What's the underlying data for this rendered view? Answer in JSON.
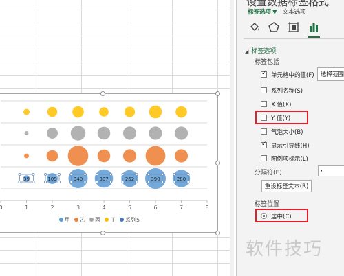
{
  "pane": {
    "title": "设置数据标签格式",
    "tab_active": "标签选项",
    "tab_caret": "▼",
    "tab_other": "文本选项",
    "icons": [
      "fill-icon",
      "pentagon-icon",
      "size-properties-icon",
      "bar-chart-icon"
    ],
    "section_title": "标签选项",
    "label_contains": "标签包括",
    "options": [
      {
        "label": "单元格中的值(F)",
        "checked": true
      },
      {
        "label": "系列名称(S)",
        "checked": false
      },
      {
        "label": "X 值(X)",
        "checked": false
      },
      {
        "label": "Y 值(Y)",
        "checked": false
      },
      {
        "label": "气泡大小(B)",
        "checked": false
      },
      {
        "label": "显示引导线(H)",
        "checked": true
      },
      {
        "label": "图例项标示(L)",
        "checked": false
      }
    ],
    "range_button": "选择范围...",
    "separator_label": "分隔符(E)",
    "separator_value": ",",
    "reset_button": "重设标签文本(R)",
    "position_label": "标签位置",
    "position_value": "居中(C)"
  },
  "watermark": "软件技巧",
  "chart_data": {
    "type": "bubble",
    "x_ticks": [
      "0",
      "1",
      "2",
      "3",
      "4",
      "5",
      "6",
      "7",
      "8"
    ],
    "xlim": [
      0,
      8
    ],
    "series": [
      {
        "name": "甲",
        "color": "#5b9bd5",
        "x": [
          1,
          2,
          3,
          4,
          5,
          6,
          7
        ],
        "y": [
          1,
          1,
          1,
          1,
          1,
          1,
          1
        ],
        "size": [
          39,
          109,
          340,
          307,
          262,
          390,
          280
        ],
        "labels": [
          "39",
          "109",
          "340",
          "307",
          "262",
          "390",
          "280"
        ]
      },
      {
        "name": "乙",
        "color": "#ed7d31",
        "x": [
          1,
          2,
          3,
          4,
          5,
          6,
          7
        ],
        "y": [
          2,
          2,
          2,
          2,
          2,
          2,
          2
        ],
        "size": [
          20,
          120,
          380,
          150,
          160,
          360,
          160
        ],
        "labels": []
      },
      {
        "name": "丙",
        "color": "#a5a5a5",
        "x": [
          1,
          2,
          3,
          4,
          5,
          6,
          7
        ],
        "y": [
          3,
          3,
          3,
          3,
          3,
          3,
          3
        ],
        "size": [
          15,
          110,
          200,
          150,
          160,
          160,
          160
        ],
        "labels": []
      },
      {
        "name": "丁",
        "color": "#ffc000",
        "x": [
          1,
          2,
          3,
          4,
          5,
          6,
          7
        ],
        "y": [
          4,
          4,
          4,
          4,
          4,
          4,
          4
        ],
        "size": [
          35,
          90,
          120,
          80,
          100,
          150,
          120
        ],
        "labels": []
      },
      {
        "name": "系列5",
        "color": "#4472c4",
        "x": [],
        "y": [],
        "size": [],
        "labels": []
      }
    ],
    "legend_position": "bottom",
    "grid": true
  }
}
